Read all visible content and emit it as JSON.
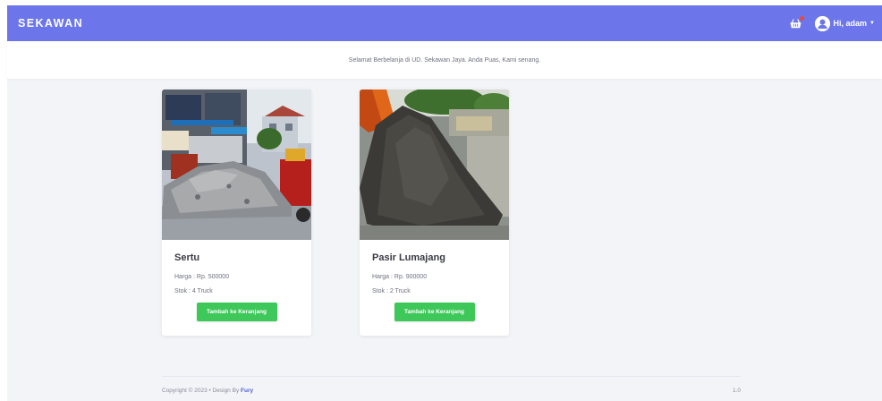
{
  "navbar": {
    "brand": "SEKAWAN",
    "user_greeting": "Hi, adam",
    "cart_icon": "basket-icon",
    "avatar_icon": "user-avatar-icon"
  },
  "welcome": {
    "text": "Selamat Berbelanja di UD. Sekawan Jaya. Anda Puas, Kami senang."
  },
  "products": [
    {
      "title": "Sertu",
      "price": "Harga : Rp. 500000",
      "stock": "Stok : 4 Truck",
      "button": "Tambah ke Keranjang"
    },
    {
      "title": "Pasir Lumajang",
      "price": "Harga : Rp. 900000",
      "stock": "Stok : 2 Truck",
      "button": "Tambah ke Keranjang"
    }
  ],
  "footer": {
    "copyright": "Copyright © 2023  •  Design By",
    "author": "Fury",
    "version": "1.0"
  },
  "colors": {
    "navbar": "#6c76ea",
    "button": "#3ec85a",
    "background": "#f3f4f8"
  }
}
